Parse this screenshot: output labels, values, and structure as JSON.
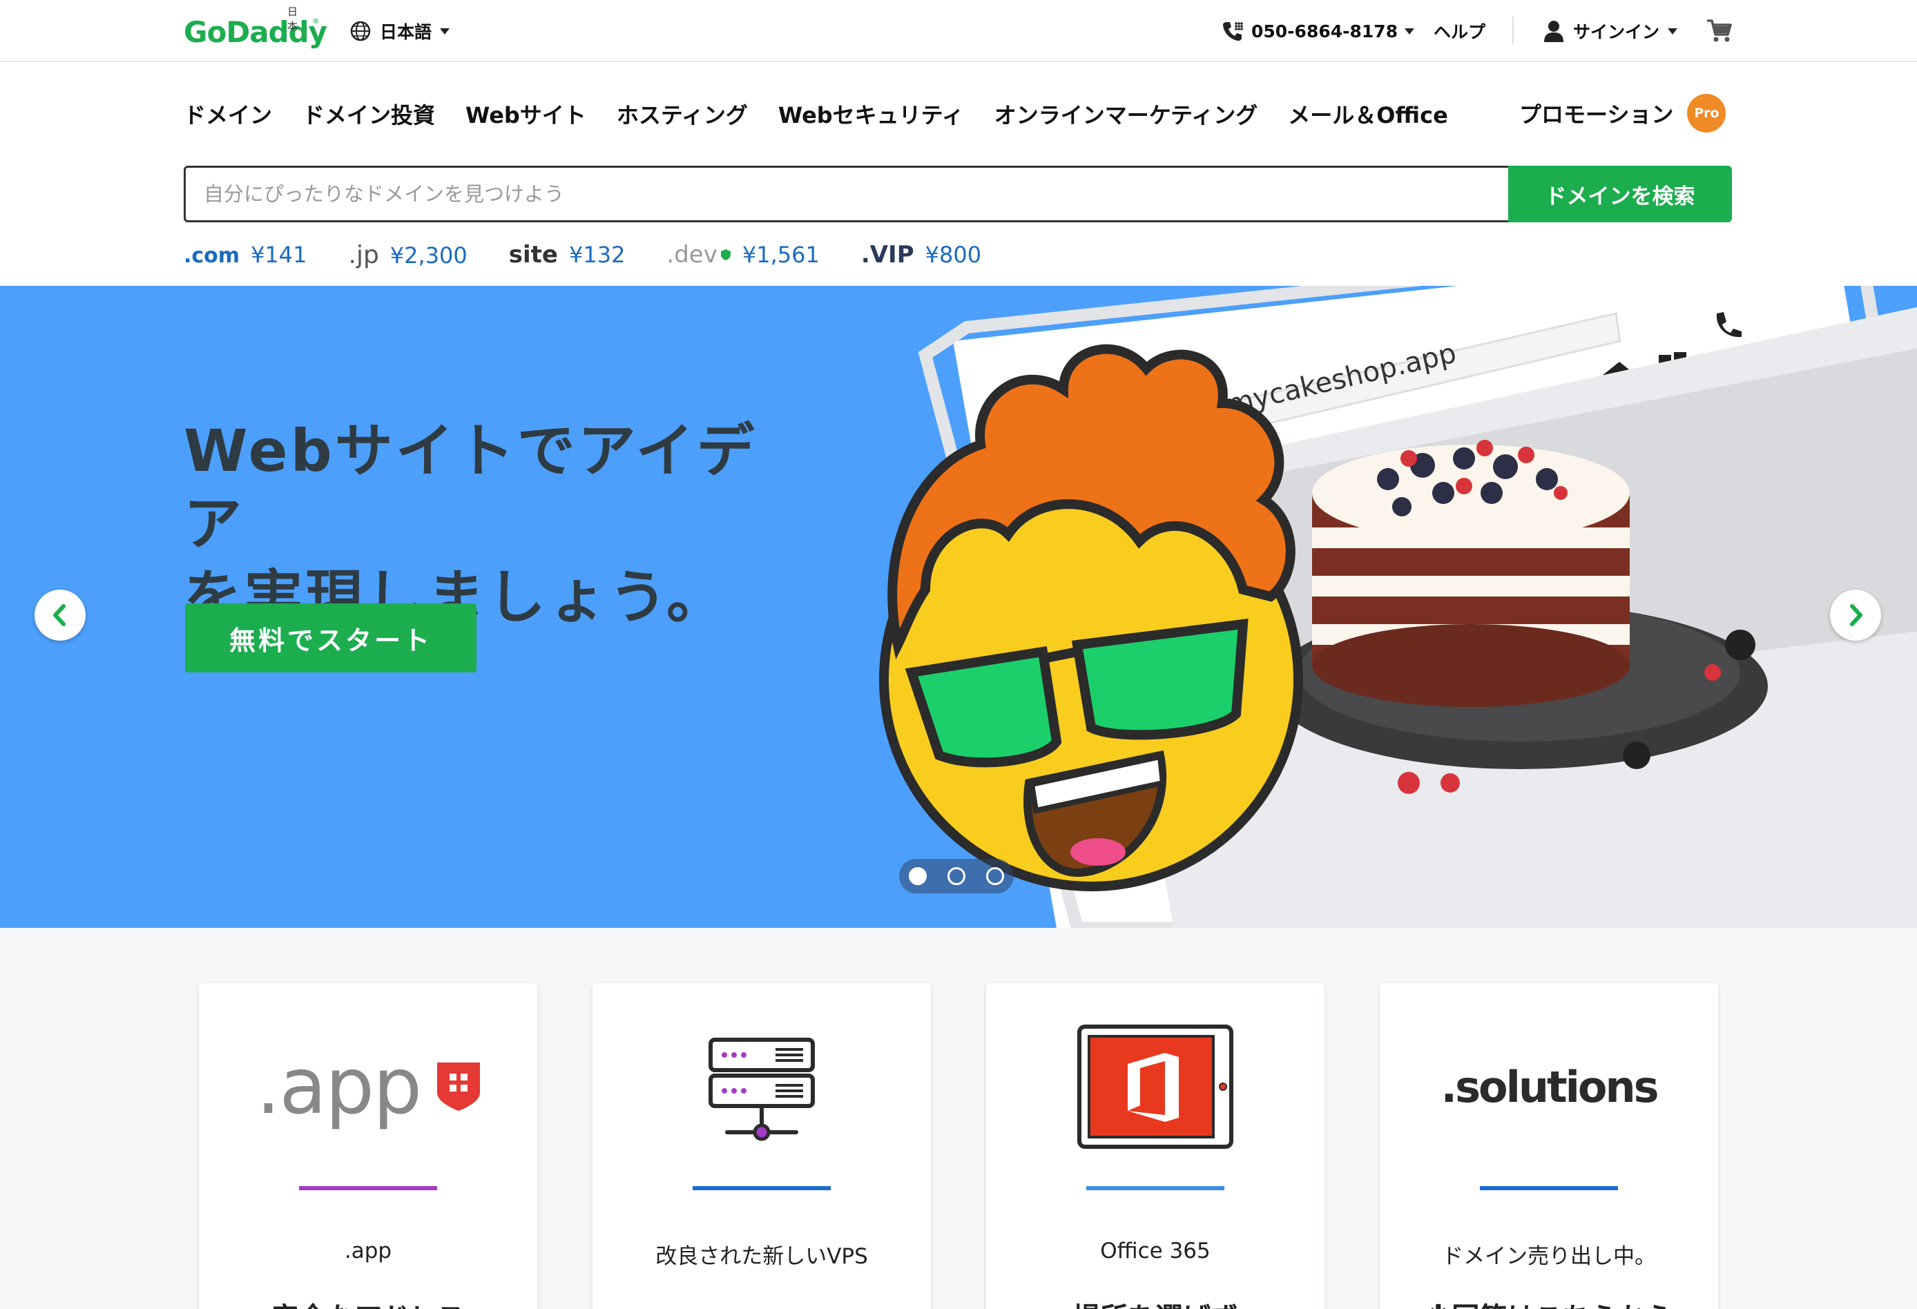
{
  "header": {
    "logo_text": "GoDaddy",
    "logo_region": "日本",
    "language": "日本語",
    "phone": "050-6864-8178",
    "help": "ヘルプ",
    "signin": "サインイン"
  },
  "nav": {
    "items": [
      "ドメイン",
      "ドメイン投資",
      "Webサイト",
      "ホスティング",
      "Webセキュリティ",
      "オンラインマーケティング",
      "メール＆Office"
    ],
    "promo": "プロモーション",
    "promo_badge": "Pro"
  },
  "search": {
    "placeholder": "自分にぴったりなドメインを見つけよう",
    "value": "",
    "button": "ドメインを検索"
  },
  "tlds": [
    {
      "name": ".com",
      "price": "¥141",
      "color": "#1a6bbf"
    },
    {
      "name": ".jp",
      "price": "¥2,300",
      "color": "#555555"
    },
    {
      "name": "site",
      "price": "¥132",
      "color": "#333333"
    },
    {
      "name": ".dev",
      "price": "¥1,561",
      "color": "#888888"
    },
    {
      "name": ".VIP",
      "price": "¥800",
      "color": "#2a3a5a"
    }
  ],
  "hero": {
    "title_line1": "Webサイトでアイデア",
    "title_line2": "を実現しましょう。",
    "cta": "無料でスタート",
    "browser_url": "mycakeshop.app",
    "bg_color": "#4c9ffb",
    "slides_total": 3,
    "slide_active": 1
  },
  "cards": [
    {
      "art_text": ".app",
      "label": ".app",
      "sub": "安全なアドレス",
      "line_color": "#a33bc7"
    },
    {
      "art_text": "",
      "label": "改良された新しいVPS",
      "sub": "",
      "line_color": "#1a6bd0"
    },
    {
      "art_text": "",
      "label": "Office 365",
      "sub": "場所を選ばず",
      "line_color": "#3a8fe0"
    },
    {
      "art_text": ".solutions",
      "label": "ドメイン売り出し中。",
      "sub": "※回答はこちらから",
      "line_color": "#1a6bd0"
    }
  ],
  "colors": {
    "brand_green": "#1bad4e",
    "link_blue": "#1a6bbf",
    "promo_orange": "#f08a24"
  }
}
